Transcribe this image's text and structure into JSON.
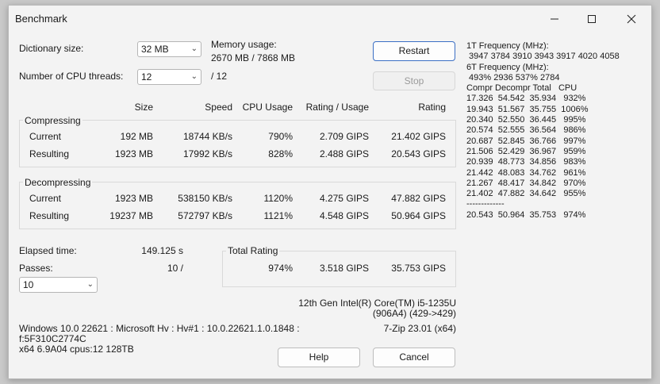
{
  "window": {
    "title": "Benchmark"
  },
  "settings": {
    "dict_label": "Dictionary size:",
    "dict_value": "32 MB",
    "threads_label": "Number of CPU threads:",
    "threads_value": "12",
    "threads_total": "/ 12",
    "memory_label": "Memory usage:",
    "memory_value": "2670 MB / 7868 MB"
  },
  "buttons": {
    "restart": "Restart",
    "stop": "Stop",
    "help": "Help",
    "cancel": "Cancel"
  },
  "columns": {
    "size": "Size",
    "speed": "Speed",
    "cpu": "CPU Usage",
    "rating_usage": "Rating / Usage",
    "rating": "Rating"
  },
  "compressing": {
    "title": "Compressing",
    "rows": [
      {
        "label": "Current",
        "size": "192 MB",
        "speed": "18744 KB/s",
        "cpu": "790%",
        "rating_usage": "2.709 GIPS",
        "rating": "21.402 GIPS"
      },
      {
        "label": "Resulting",
        "size": "1923 MB",
        "speed": "17992 KB/s",
        "cpu": "828%",
        "rating_usage": "2.488 GIPS",
        "rating": "20.543 GIPS"
      }
    ]
  },
  "decompressing": {
    "title": "Decompressing",
    "rows": [
      {
        "label": "Current",
        "size": "1923 MB",
        "speed": "538150 KB/s",
        "cpu": "1120%",
        "rating_usage": "4.275 GIPS",
        "rating": "47.882 GIPS"
      },
      {
        "label": "Resulting",
        "size": "19237 MB",
        "speed": "572797 KB/s",
        "cpu": "1121%",
        "rating_usage": "4.548 GIPS",
        "rating": "50.964 GIPS"
      }
    ]
  },
  "elapsed": {
    "label": "Elapsed time:",
    "value": "149.125 s"
  },
  "passes": {
    "label": "Passes:",
    "value": "10 /",
    "select": "10"
  },
  "total": {
    "title": "Total Rating",
    "cpu": "974%",
    "rating_usage": "3.518 GIPS",
    "rating": "35.753 GIPS"
  },
  "cpu_info": {
    "line1": "12th Gen Intel(R) Core(TM) i5-1235U",
    "line2": "(906A4) (429->429)",
    "version": "7-Zip 23.01 (x64)"
  },
  "sys_info": {
    "line1": "Windows 10.0 22621 : Microsoft Hv : Hv#1 : 10.0.22621.1.0.1848 :",
    "line2": "f:5F310C2774C",
    "line3": "x64 6.9A04 cpus:12 128TB"
  },
  "freq": {
    "label_1t": "1T Frequency (MHz):",
    "values_1t": " 3947 3784 3910 3943 3917 4020 4058",
    "label_6t": "6T Frequency (MHz):",
    "values_6t": " 493% 2936 537% 2784",
    "header": "Compr Decompr Total   CPU",
    "rows": [
      "17.326  54.542  35.934   932%",
      "19.943  51.567  35.755  1006%",
      "20.340  52.550  36.445   995%",
      "20.574  52.555  36.564   986%",
      "20.687  52.845  36.766   997%",
      "21.506  52.429  36.967   959%",
      "20.939  48.773  34.856   983%",
      "21.442  48.083  34.762   961%",
      "21.267  48.417  34.842   970%",
      "21.402  47.882  34.642   955%"
    ],
    "separator": "-------------",
    "summary": "20.543  50.964  35.753   974%"
  }
}
